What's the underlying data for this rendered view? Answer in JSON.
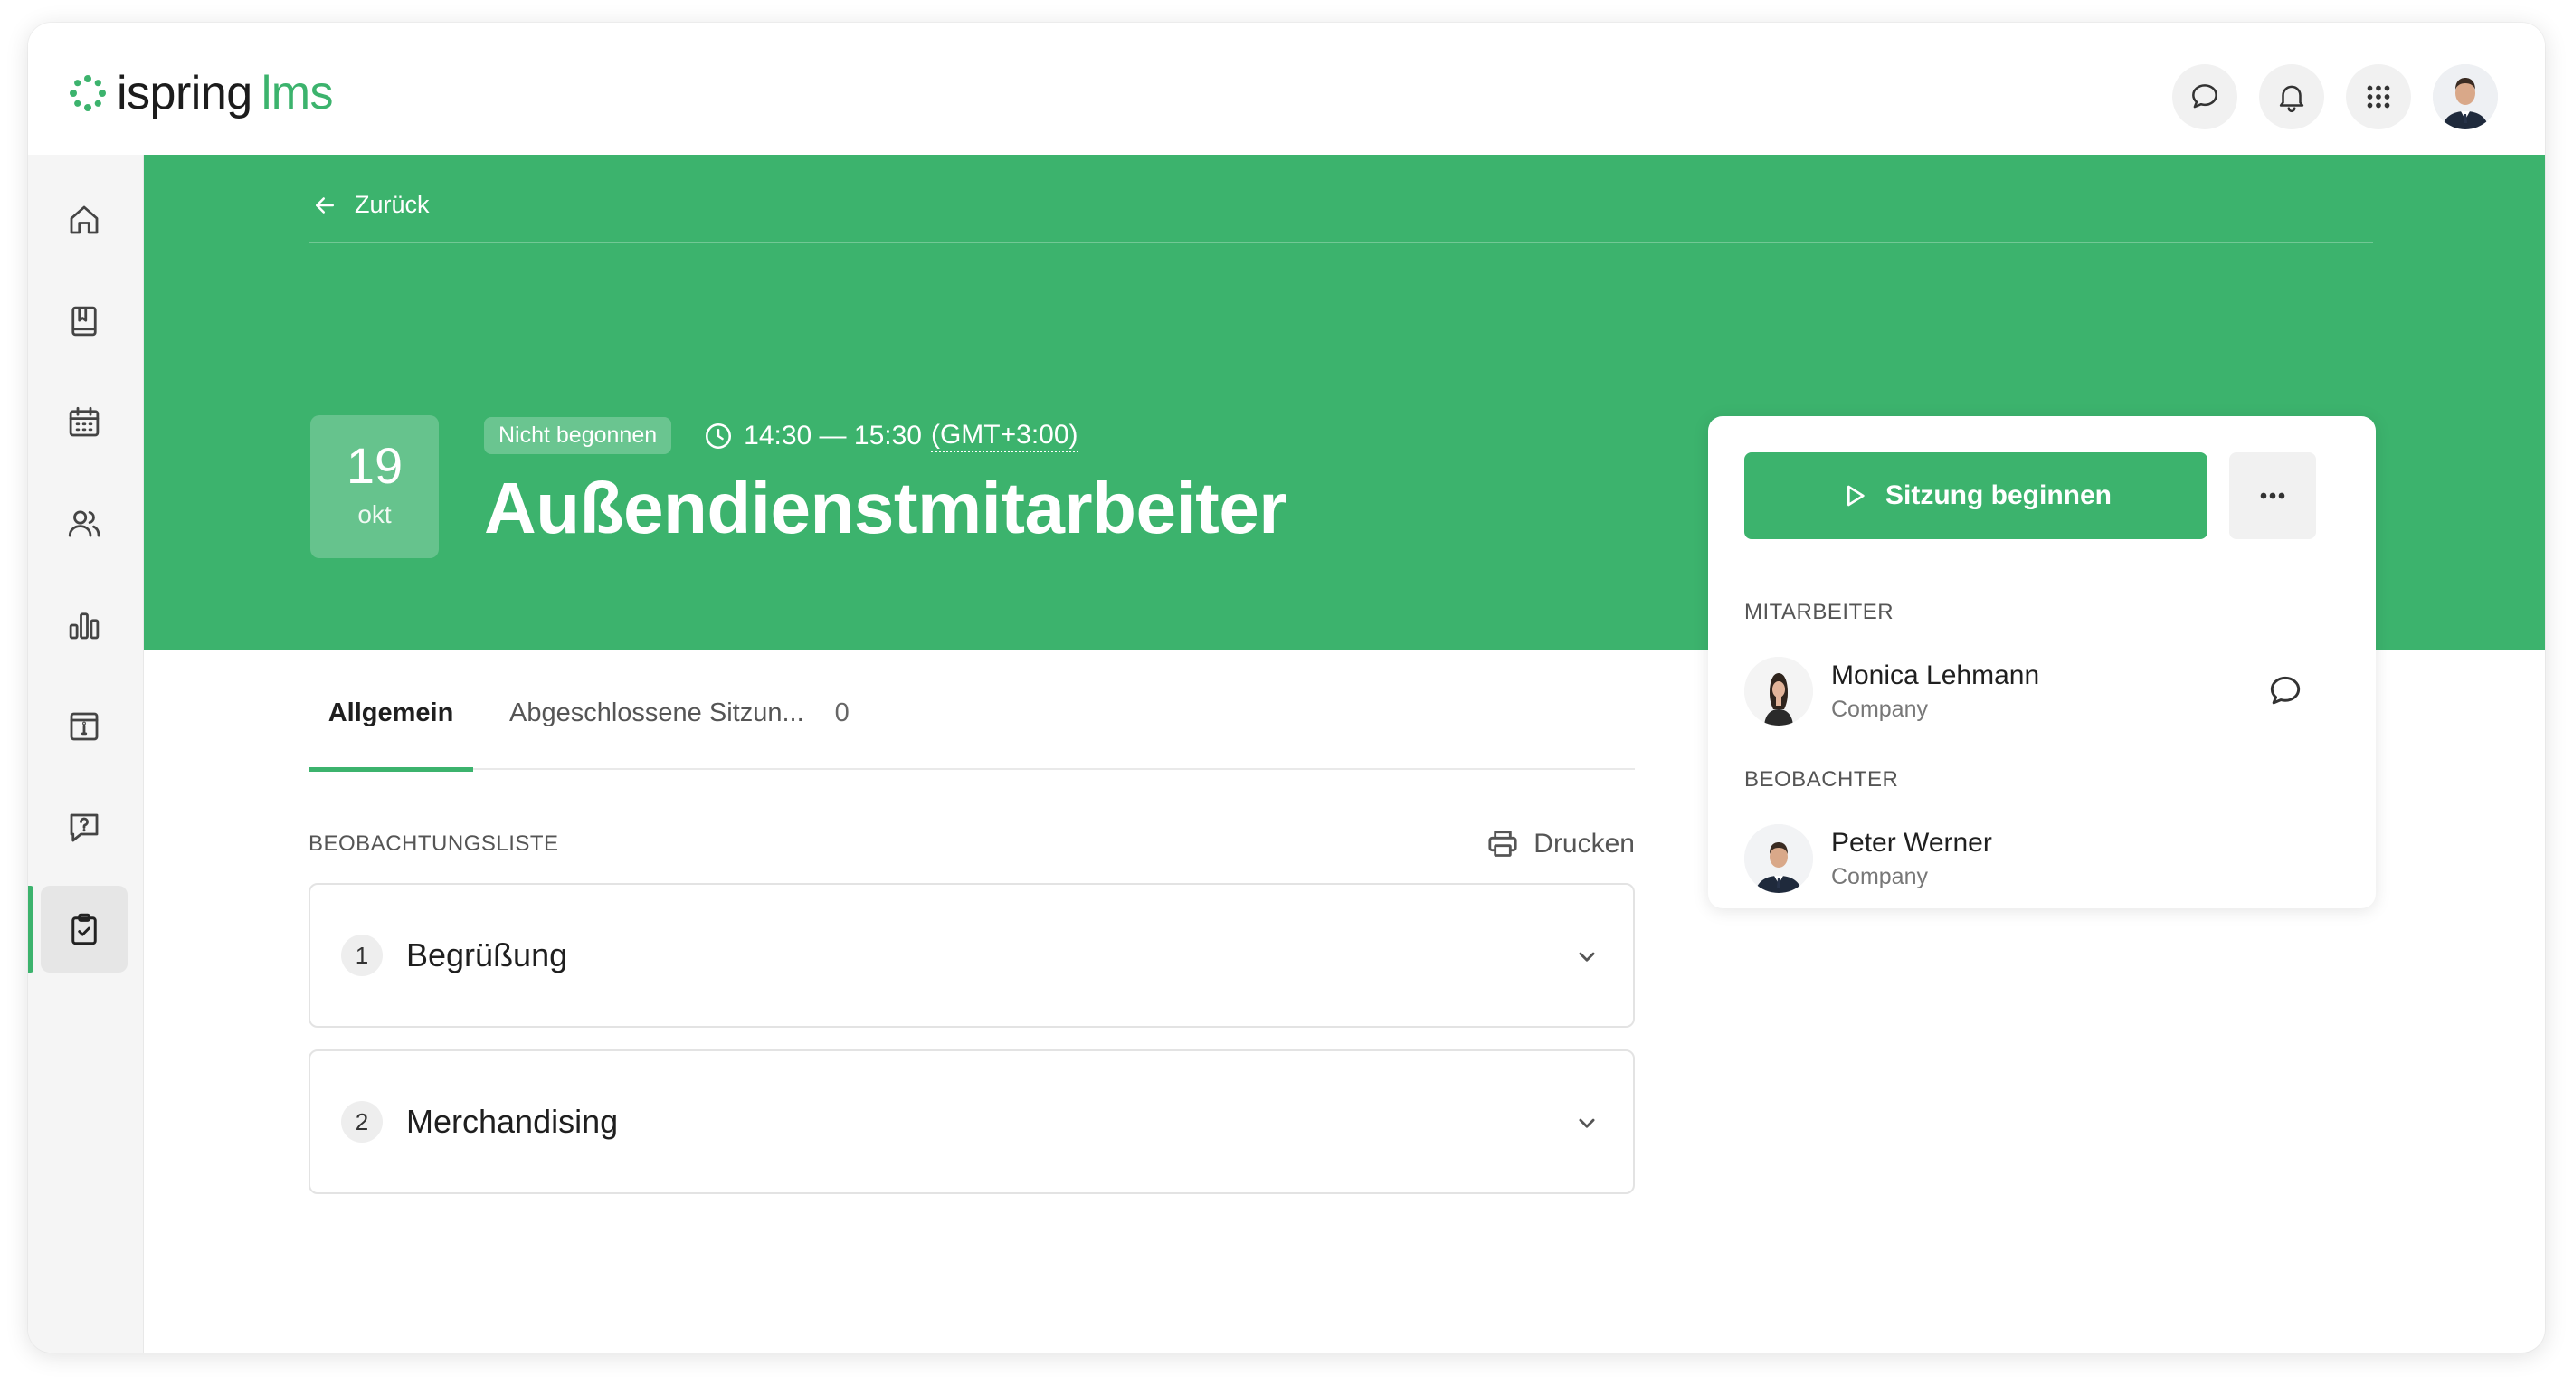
{
  "app": {
    "brand": "ispring",
    "product": "lms",
    "accent_color": "#3cb36d"
  },
  "header": {
    "icons": [
      "chat-icon",
      "bell-icon",
      "apps-grid-icon"
    ]
  },
  "sidebar": {
    "items": [
      {
        "name": "home-icon"
      },
      {
        "name": "book-icon"
      },
      {
        "name": "calendar-icon"
      },
      {
        "name": "users-icon"
      },
      {
        "name": "bar-chart-icon"
      },
      {
        "name": "info-board-icon"
      },
      {
        "name": "question-chat-icon"
      },
      {
        "name": "clipboard-check-icon",
        "active": true
      }
    ]
  },
  "banner": {
    "back_label": "Zurück",
    "date_day": "19",
    "date_month": "okt",
    "status": "Nicht begonnen",
    "time_range": "14:30 — 15:30",
    "timezone": "(GMT+3:00)",
    "title": "Außendienstmitarbeiter"
  },
  "tabs": [
    {
      "label": "Allgemein",
      "active": true
    },
    {
      "label": "Abgeschlossene Sitzun...",
      "count": "0"
    }
  ],
  "checklist": {
    "section_label": "BEOBACHTUNGSLISTE",
    "print_label": "Drucken",
    "items": [
      {
        "number": "1",
        "title": "Begrüßung"
      },
      {
        "number": "2",
        "title": "Merchandising"
      }
    ]
  },
  "panel": {
    "start_label": "Sitzung beginnen",
    "employee_label": "MITARBEITER",
    "employee": {
      "name": "Monica Lehmann",
      "company": "Company"
    },
    "observer_label": "BEOBACHTER",
    "observer": {
      "name": "Peter Werner",
      "company": "Company"
    }
  }
}
